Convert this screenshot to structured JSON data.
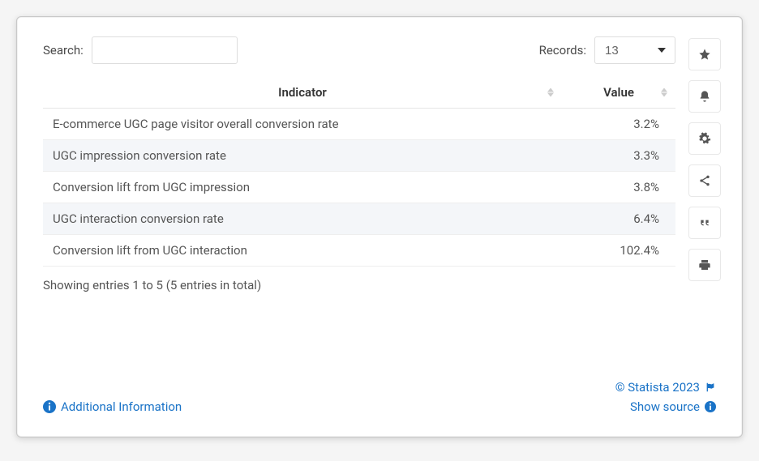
{
  "toolbar": {
    "search_label": "Search:",
    "search_value": "",
    "records_label": "Records:",
    "records_value": "13"
  },
  "table": {
    "headers": {
      "indicator": "Indicator",
      "value": "Value"
    },
    "rows": [
      {
        "indicator": "E-commerce UGC page visitor overall conversion rate",
        "value": "3.2%"
      },
      {
        "indicator": "UGC impression conversion rate",
        "value": "3.3%"
      },
      {
        "indicator": "Conversion lift from UGC impression",
        "value": "3.8%"
      },
      {
        "indicator": "UGC interaction conversion rate",
        "value": "6.4%"
      },
      {
        "indicator": "Conversion lift from UGC interaction",
        "value": "102.4%"
      }
    ]
  },
  "footer_info": "Showing entries 1 to 5 (5 entries in total)",
  "links": {
    "additional_info": "Additional Information",
    "copyright": "© Statista 2023",
    "show_source": "Show source"
  },
  "actions": {
    "favorite": "star-icon",
    "notify": "bell-icon",
    "settings": "gear-icon",
    "share": "share-icon",
    "cite": "quote-icon",
    "print": "print-icon"
  }
}
